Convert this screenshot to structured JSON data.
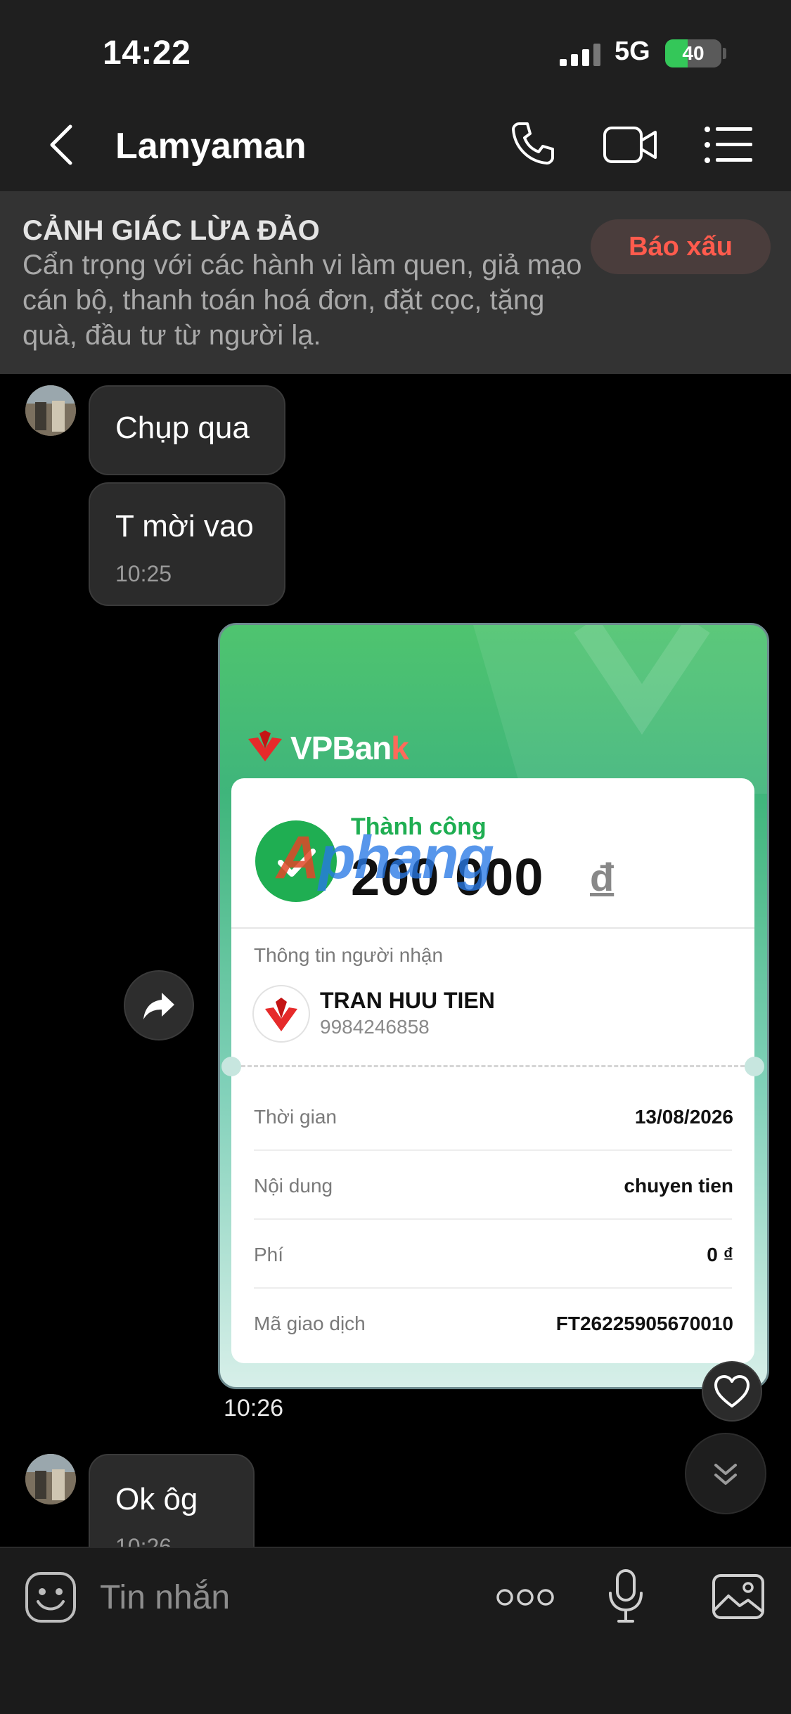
{
  "status_bar": {
    "time": "14:22",
    "network": "5G",
    "battery": "40",
    "battery_level": 0.4
  },
  "header": {
    "contact_name": "Lamyaman"
  },
  "warning": {
    "title": "CẢNH GIÁC LỪA ĐẢO",
    "body": "Cẩn trọng với các hành vi làm quen, giả mạo cán bộ, thanh toán hoá đơn, đặt cọc, tặng quà, đầu tư từ người lạ.",
    "report_label": "Báo xấu"
  },
  "messages": {
    "m1": {
      "text": "Chụp qua"
    },
    "m2": {
      "text": "T mời vao",
      "time": "10:25"
    },
    "image_time": "10:26",
    "m3": {
      "text": "Ok ôg",
      "time": "10:26"
    }
  },
  "receipt": {
    "bank_name_main": "VPBan",
    "bank_name_k": "k",
    "watermark_a": "A",
    "watermark_rest": "phang",
    "status": "Thành công",
    "amount": "200 000",
    "currency": "đ",
    "recipient_label": "Thông tin người nhận",
    "recipient_name": "TRAN HUU TIEN",
    "recipient_account": "9984246858",
    "rows": [
      {
        "label": "Thời gian",
        "value": "13/08/2026"
      },
      {
        "label": "Nội dung",
        "value": "chuyen tien"
      },
      {
        "label": "Phí",
        "value": "0 ₫"
      },
      {
        "label": "Mã giao dịch",
        "value": "FT26225905670010"
      }
    ]
  },
  "input": {
    "placeholder": "Tin nhắn"
  },
  "colors": {
    "accent_red": "#ff5b4d",
    "success_green": "#1fae52",
    "background": "#000000"
  },
  "icons": [
    "back-icon",
    "phone-icon",
    "video-icon",
    "menu-icon",
    "share-icon",
    "heart-icon",
    "chevron-down-icon",
    "sticker-icon",
    "more-icon",
    "mic-icon",
    "gallery-icon",
    "check-icon",
    "vpbank-logo-icon"
  ]
}
